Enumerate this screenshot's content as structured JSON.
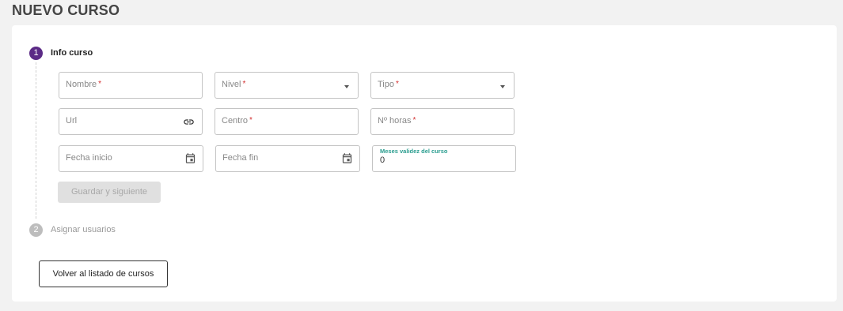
{
  "page": {
    "title": "NUEVO CURSO"
  },
  "steps": [
    {
      "number": "1",
      "label": "Info curso",
      "state": "active"
    },
    {
      "number": "2",
      "label": "Asignar usuarios",
      "state": "inactive"
    }
  ],
  "form": {
    "nombre": {
      "placeholder": "Nombre",
      "required": "*"
    },
    "nivel": {
      "placeholder": "Nivel",
      "required": "*",
      "icon": "caret-down-icon"
    },
    "tipo": {
      "placeholder": "Tipo",
      "required": "*",
      "icon": "caret-down-icon"
    },
    "url": {
      "placeholder": "Url",
      "icon": "link-icon"
    },
    "centro": {
      "placeholder": "Centro",
      "required": "*"
    },
    "horas": {
      "placeholder": "Nº horas",
      "required": "*"
    },
    "fecha_inicio": {
      "placeholder": "Fecha inicio",
      "icon": "calendar-icon"
    },
    "fecha_fin": {
      "placeholder": "Fecha fin",
      "icon": "calendar-icon"
    },
    "meses": {
      "label": "Meses validez del curso",
      "value": "0"
    }
  },
  "buttons": {
    "save_next": "Guardar y siguiente",
    "back": "Volver al listado de cursos"
  },
  "colors": {
    "accent": "#5b2a86",
    "required": "#d32f2f",
    "focus_label": "#2a9d8f"
  }
}
